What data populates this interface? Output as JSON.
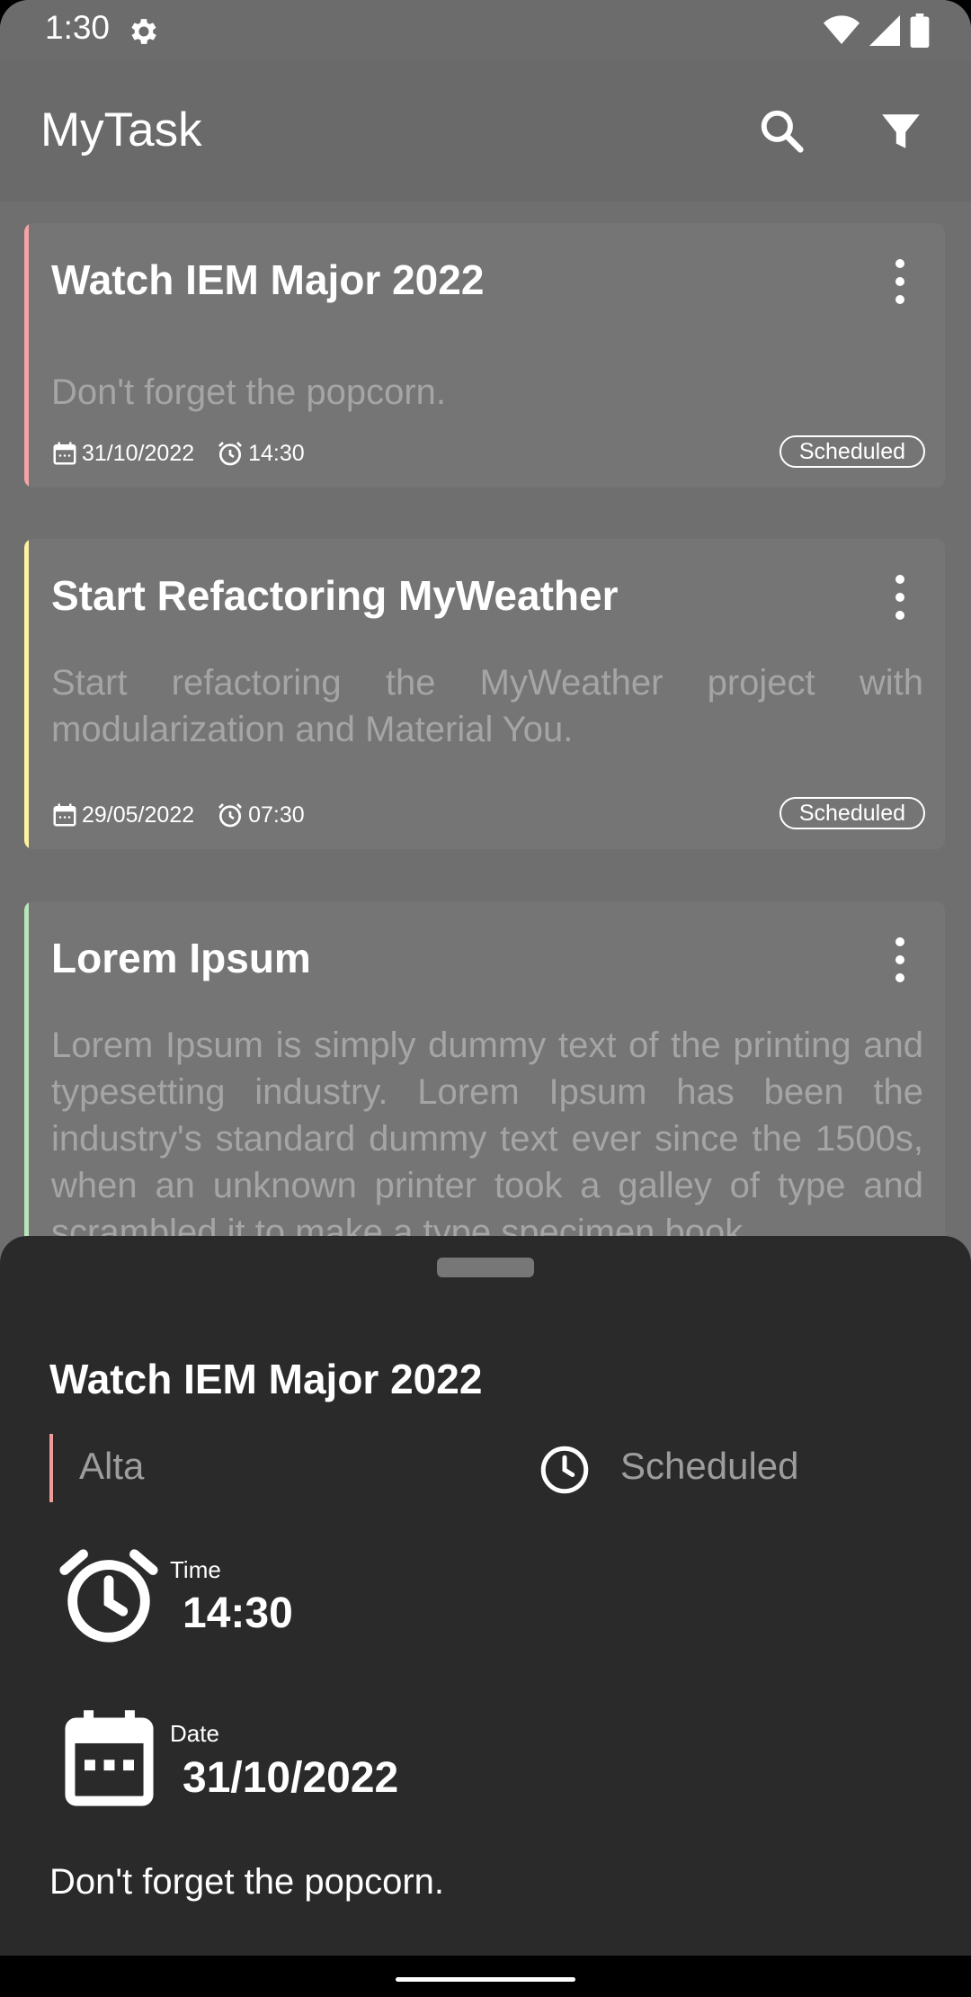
{
  "status_bar": {
    "time": "1:30"
  },
  "app_bar": {
    "title": "MyTask"
  },
  "tasks": [
    {
      "title": "Watch IEM Major 2022",
      "description": "Don't forget the popcorn.",
      "date": "31/10/2022",
      "time": "14:30",
      "status": "Scheduled",
      "accent": "#f4a4a4"
    },
    {
      "title": "Start Refactoring MyWeather",
      "description": "Start refactoring the MyWeather project with modularization and Material You.",
      "date": "29/05/2022",
      "time": "07:30",
      "status": "Scheduled",
      "accent": "#fff3a0"
    },
    {
      "title": "Lorem Ipsum",
      "description": "Lorem Ipsum is simply dummy text of the printing and typesetting industry. Lorem Ipsum has been the industry's standard dummy text ever since the 1500s, when an unknown printer took a galley of type and scrambled it to make a type specimen book.",
      "accent": "#b9e6b9"
    }
  ],
  "detail_sheet": {
    "title": "Watch IEM Major 2022",
    "priority": "Alta",
    "priority_color": "#f09a9a",
    "status": "Scheduled",
    "time_label": "Time",
    "time_value": "14:30",
    "date_label": "Date",
    "date_value": "31/10/2022",
    "description": "Don't forget the popcorn."
  },
  "icons": {
    "status_bar": [
      "gear-icon",
      "wifi-icon",
      "signal-icon",
      "battery-icon"
    ],
    "app_bar": [
      "search-icon",
      "filter-icon"
    ],
    "card": [
      "more-vert-icon",
      "calendar-icon",
      "alarm-icon"
    ],
    "sheet": [
      "clock-icon",
      "alarm-clock-icon",
      "calendar-icon"
    ]
  }
}
